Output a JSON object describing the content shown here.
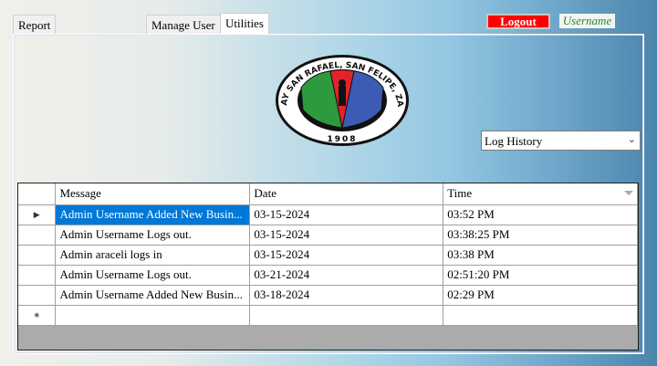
{
  "tabs": [
    {
      "label": "Report"
    },
    {
      "label": "Manage User"
    },
    {
      "label": "Utilities",
      "active": true
    }
  ],
  "header": {
    "logout_label": "Logout",
    "username": "Username"
  },
  "seal": {
    "text": "BARANGAY SAN RAFAEL, SAN FELIPE, ZAMBALES",
    "year": "1908"
  },
  "log_select": {
    "value": "Log History"
  },
  "grid": {
    "columns": [
      "Message",
      "Date",
      "Time"
    ],
    "rows": [
      {
        "message": "Admin Username Added New Busin...",
        "date": "03-15-2024",
        "time": "03:52 PM"
      },
      {
        "message": "Admin Username Logs out.",
        "date": "03-15-2024",
        "time": "03:38:25 PM"
      },
      {
        "message": "Admin araceli logs in",
        "date": "03-15-2024",
        "time": "03:38 PM"
      },
      {
        "message": "Admin Username Logs out.",
        "date": "03-21-2024",
        "time": "02:51:20 PM"
      },
      {
        "message": "Admin Username Added New Busin...",
        "date": "03-18-2024",
        "time": "02:29 PM"
      }
    ],
    "selected_row": 0
  },
  "colors": {
    "logout_bg": "#ff0000",
    "selection": "#0078d7",
    "username_text": "#2a8a2a"
  }
}
